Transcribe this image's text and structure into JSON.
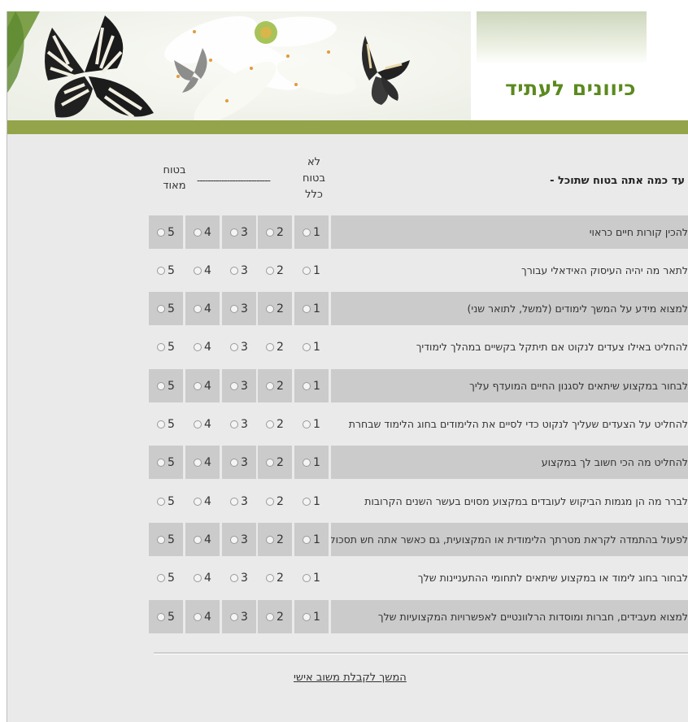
{
  "header": {
    "site_title": "כיוונים לעתיד"
  },
  "survey": {
    "question_header": "עד כמה אתה בטוח שתוכל -",
    "scale_low_label": "לא בטוח כלל",
    "scale_dashes": "---------------------------",
    "scale_high_label": "בטוח מאוד",
    "options": [
      "1",
      "2",
      "3",
      "4",
      "5"
    ],
    "items": [
      "להכין קורות חיים כראוי",
      "לתאר מה יהיה העיסוק האידאלי עבורך",
      "למצוא מידע על המשך לימודים (למשל, לתואר שני)",
      "להחליט באילו צעדים לנקוט אם תיתקל בקשיים במהלך לימודיך",
      "לבחור במקצוע שיתאים לסגנון החיים המועדף עליך",
      "להחליט על הצעדים שעליך לנקוט כדי לסיים את הלימודים בחוג הלימוד שבחרת",
      "להחליט מה הכי חשוב לך במקצוע",
      "לברר מה הן מגמות הביקוש לעובדים במקצוע מסוים בעשר השנים הקרובות",
      "לפעול בהתמדה לקראת מטרתך הלימודית או המקצועית, גם כאשר אתה חש תסכול",
      "לבחור בחוג לימוד או במקצוע שיתאים לתחומי ההתעניינות שלך",
      "למצוא מעבידים, חברות ומוסדות הרלוונטיים לאפשרויות המקצועיות שלך"
    ]
  },
  "footer": {
    "continue_link": "המשך לקבלת משוב אישי"
  }
}
